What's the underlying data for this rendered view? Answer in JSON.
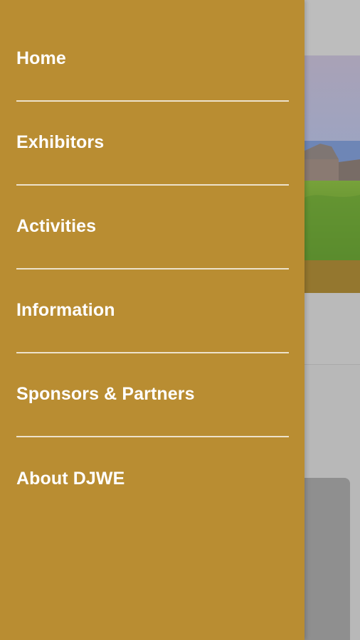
{
  "drawer": {
    "background_color": "#b98d32",
    "items": [
      {
        "label": "Home"
      },
      {
        "label": "Exhibitors"
      },
      {
        "label": "Activities"
      },
      {
        "label": "Information"
      },
      {
        "label": "Sponsors & Partners"
      },
      {
        "label": "About DJWE"
      }
    ]
  },
  "background": {
    "hero_image": "landscape-photo"
  }
}
